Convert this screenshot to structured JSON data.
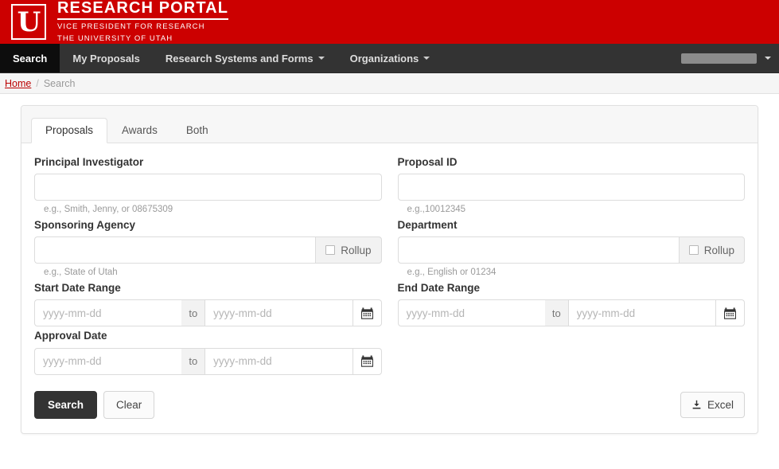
{
  "masthead": {
    "logo_letter": "U",
    "title": "RESEARCH PORTAL",
    "subtitle_line1": "VICE PRESIDENT FOR RESEARCH",
    "subtitle_line2": "THE UNIVERSITY OF UTAH",
    "brand_color": "#cc0000"
  },
  "nav": {
    "items": [
      {
        "label": "Search",
        "active": true,
        "has_caret": false
      },
      {
        "label": "My Proposals",
        "active": false,
        "has_caret": false
      },
      {
        "label": "Research Systems and Forms",
        "active": false,
        "has_caret": true
      },
      {
        "label": "Organizations",
        "active": false,
        "has_caret": true
      }
    ],
    "user_menu": {
      "label": "",
      "redacted": true
    }
  },
  "breadcrumb": {
    "home": "Home",
    "separator": "/",
    "current": "Search"
  },
  "tabs": [
    {
      "label": "Proposals",
      "active": true
    },
    {
      "label": "Awards",
      "active": false
    },
    {
      "label": "Both",
      "active": false
    }
  ],
  "form": {
    "principal_investigator": {
      "label": "Principal Investigator",
      "value": "",
      "placeholder": "",
      "help": "e.g., Smith, Jenny, or 08675309"
    },
    "proposal_id": {
      "label": "Proposal ID",
      "value": "",
      "placeholder": "",
      "help": "e.g.,10012345"
    },
    "sponsoring_agency": {
      "label": "Sponsoring Agency",
      "value": "",
      "placeholder": "",
      "help": "e.g., State of Utah",
      "rollup_label": "Rollup",
      "rollup_checked": false
    },
    "department": {
      "label": "Department",
      "value": "",
      "placeholder": "",
      "help": "e.g., English or 01234",
      "rollup_label": "Rollup",
      "rollup_checked": false
    },
    "start_date_range": {
      "label": "Start Date Range",
      "from_value": "",
      "from_placeholder": "yyyy-mm-dd",
      "separator": "to",
      "to_value": "",
      "to_placeholder": "yyyy-mm-dd"
    },
    "end_date_range": {
      "label": "End Date Range",
      "from_value": "",
      "from_placeholder": "yyyy-mm-dd",
      "separator": "to",
      "to_value": "",
      "to_placeholder": "yyyy-mm-dd"
    },
    "approval_date": {
      "label": "Approval Date",
      "from_value": "",
      "from_placeholder": "yyyy-mm-dd",
      "separator": "to",
      "to_value": "",
      "to_placeholder": "yyyy-mm-dd"
    }
  },
  "actions": {
    "search_label": "Search",
    "clear_label": "Clear",
    "excel_label": "Excel"
  }
}
